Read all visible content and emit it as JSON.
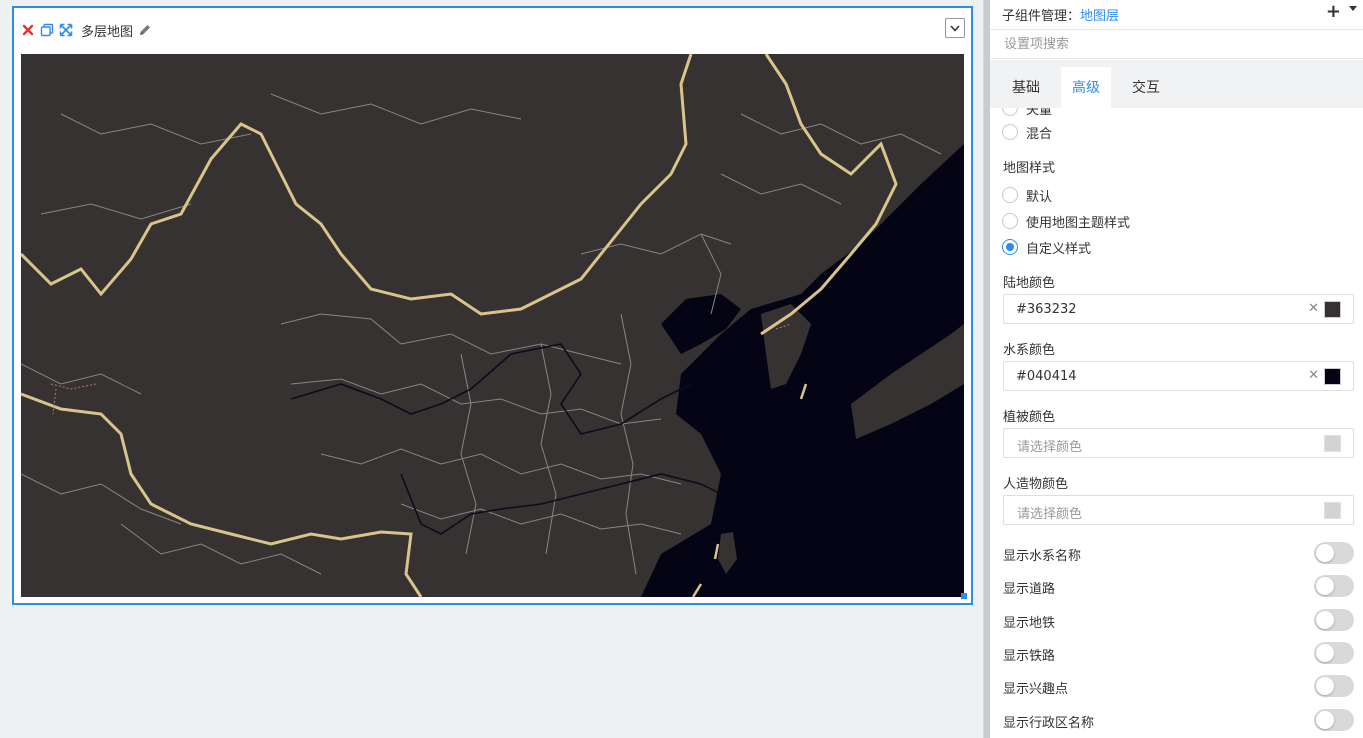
{
  "widget": {
    "title": "多层地图",
    "map_land_color": "#363232",
    "map_water_color": "#040414",
    "map_border_color": "#d9c48a"
  },
  "panel": {
    "header_label": "子组件管理：",
    "header_link": "地图层",
    "add_icon": "plus-icon",
    "search_placeholder": "设置项搜索",
    "tabs": [
      {
        "label": "基础",
        "active": false
      },
      {
        "label": "高级",
        "active": true
      },
      {
        "label": "交互",
        "active": false
      }
    ],
    "render_mode": {
      "options": [
        {
          "label": "矢量",
          "checked": false
        },
        {
          "label": "混合",
          "checked": false
        }
      ]
    },
    "map_style": {
      "label": "地图样式",
      "options": [
        {
          "label": "默认",
          "checked": false
        },
        {
          "label": "使用地图主题样式",
          "checked": false
        },
        {
          "label": "自定义样式",
          "checked": true
        }
      ]
    },
    "colors": [
      {
        "label": "陆地颜色",
        "value": "#363232",
        "placeholder": "",
        "swatch": "#363232"
      },
      {
        "label": "水系颜色",
        "value": "#040414",
        "placeholder": "",
        "swatch": "#040414"
      },
      {
        "label": "植被颜色",
        "value": "",
        "placeholder": "请选择颜色",
        "swatch": "#d3d3d3"
      },
      {
        "label": "人造物颜色",
        "value": "",
        "placeholder": "请选择颜色",
        "swatch": "#d3d3d3"
      }
    ],
    "toggles": [
      {
        "label": "显示水系名称",
        "on": false
      },
      {
        "label": "显示道路",
        "on": false
      },
      {
        "label": "显示地铁",
        "on": false
      },
      {
        "label": "显示铁路",
        "on": false
      },
      {
        "label": "显示兴趣点",
        "on": false
      },
      {
        "label": "显示行政区名称",
        "on": false
      }
    ]
  }
}
